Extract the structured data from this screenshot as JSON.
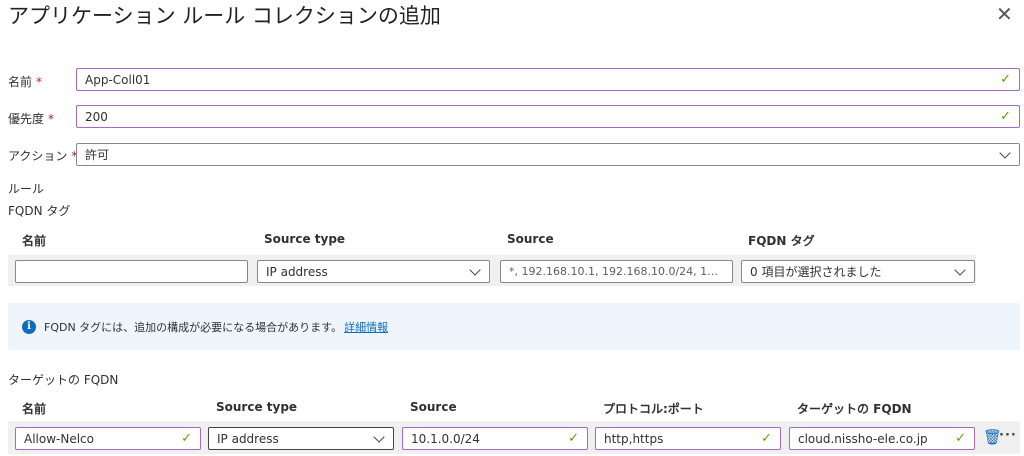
{
  "title": "アプリケーション ルール コレクションの追加",
  "form": {
    "name": {
      "label": "名前",
      "value": "App-Coll01"
    },
    "priority": {
      "label": "優先度",
      "value": "200"
    },
    "action": {
      "label": "アクション",
      "value": "許可"
    },
    "required_mark": "*"
  },
  "rules_label": "ルール",
  "fqdn_tags": {
    "section_label": "FQDN タグ",
    "headers": [
      "名前",
      "Source type",
      "Source",
      "FQDN タグ"
    ],
    "row": {
      "name": "",
      "source_type": "IP address",
      "source_placeholder": "*, 192.168.10.1, 192.168.10.0/24, 192.1...",
      "fqdn_tag": "0 項目が選択されました"
    }
  },
  "info": {
    "text": "FQDN タグには、追加の構成が必要になる場合があります。",
    "link": "詳細情報"
  },
  "target_fqdns": {
    "section_label": "ターゲットの FQDN",
    "headers": [
      "名前",
      "Source type",
      "Source",
      "プロトコル:ポート",
      "ターゲットの FQDN"
    ],
    "row": {
      "name": "Allow-Nelco",
      "source_type": "IP address",
      "source": "10.1.0.0/24",
      "protocol_port": "http,https",
      "target_fqdn": "cloud.nissho-ele.co.jp"
    }
  },
  "colors": {
    "valid_border": "#a36ac4",
    "check": "#57a300",
    "accent": "#0f6cbd"
  }
}
